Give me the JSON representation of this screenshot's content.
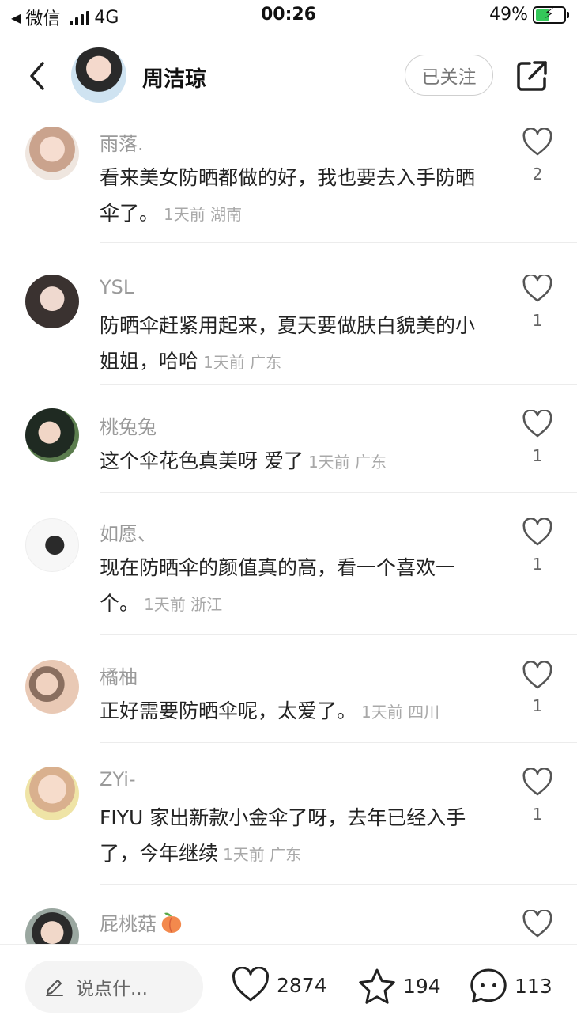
{
  "status_bar": {
    "carrier": "微信",
    "network": "4G",
    "time": "00:26",
    "battery_percent": "49%",
    "battery_level": 0.49,
    "battery_color": "#34c759"
  },
  "header": {
    "back_icon": "chevron-left-icon",
    "author_name": "周洁琼",
    "follow_label": "已关注",
    "share_icon": "share-icon"
  },
  "comments": [
    {
      "user": "雨落.",
      "text": "看来美女防晒都做的好，我也要去入手防晒伞了。",
      "time": "1天前",
      "location": "湖南",
      "likes": "2",
      "avatar_color": "#e8cbbb"
    },
    {
      "user": "YSL",
      "text": "防晒伞赶紧用起来，夏天要做肤白貌美的小姐姐，哈哈",
      "time": "1天前",
      "location": "广东",
      "likes": "1",
      "avatar_color": "#3a3230"
    },
    {
      "user": "桃兔兔",
      "text": "这个伞花色真美呀 爱了",
      "time": "1天前",
      "location": "广东",
      "likes": "1",
      "avatar_color": "#1f2a22"
    },
    {
      "user": "如愿、",
      "text": "现在防晒伞的颜值真的高，看一个喜欢一个。",
      "time": "1天前",
      "location": "浙江",
      "likes": "1",
      "avatar_color": "#f2f2f2"
    },
    {
      "user": "橘柚",
      "text": "正好需要防晒伞呢，太爱了。",
      "time": "1天前",
      "location": "四川",
      "likes": "1",
      "avatar_color": "#e9c9b5"
    },
    {
      "user": "ZYi-",
      "text": "FIYU 家出新款小金伞了呀，去年已经入手了，今年继续",
      "time": "1天前",
      "location": "广东",
      "likes": "1",
      "avatar_color": "#d9b08e"
    },
    {
      "user": "屁桃菇",
      "text": "",
      "time": "",
      "location": "",
      "likes": "",
      "avatar_color": "#9aa7a0",
      "emoji_icon": "peach-icon"
    }
  ],
  "bottom_bar": {
    "input_placeholder": "说点什...",
    "likes_count": "2874",
    "favorites_count": "194",
    "comments_count": "113"
  }
}
